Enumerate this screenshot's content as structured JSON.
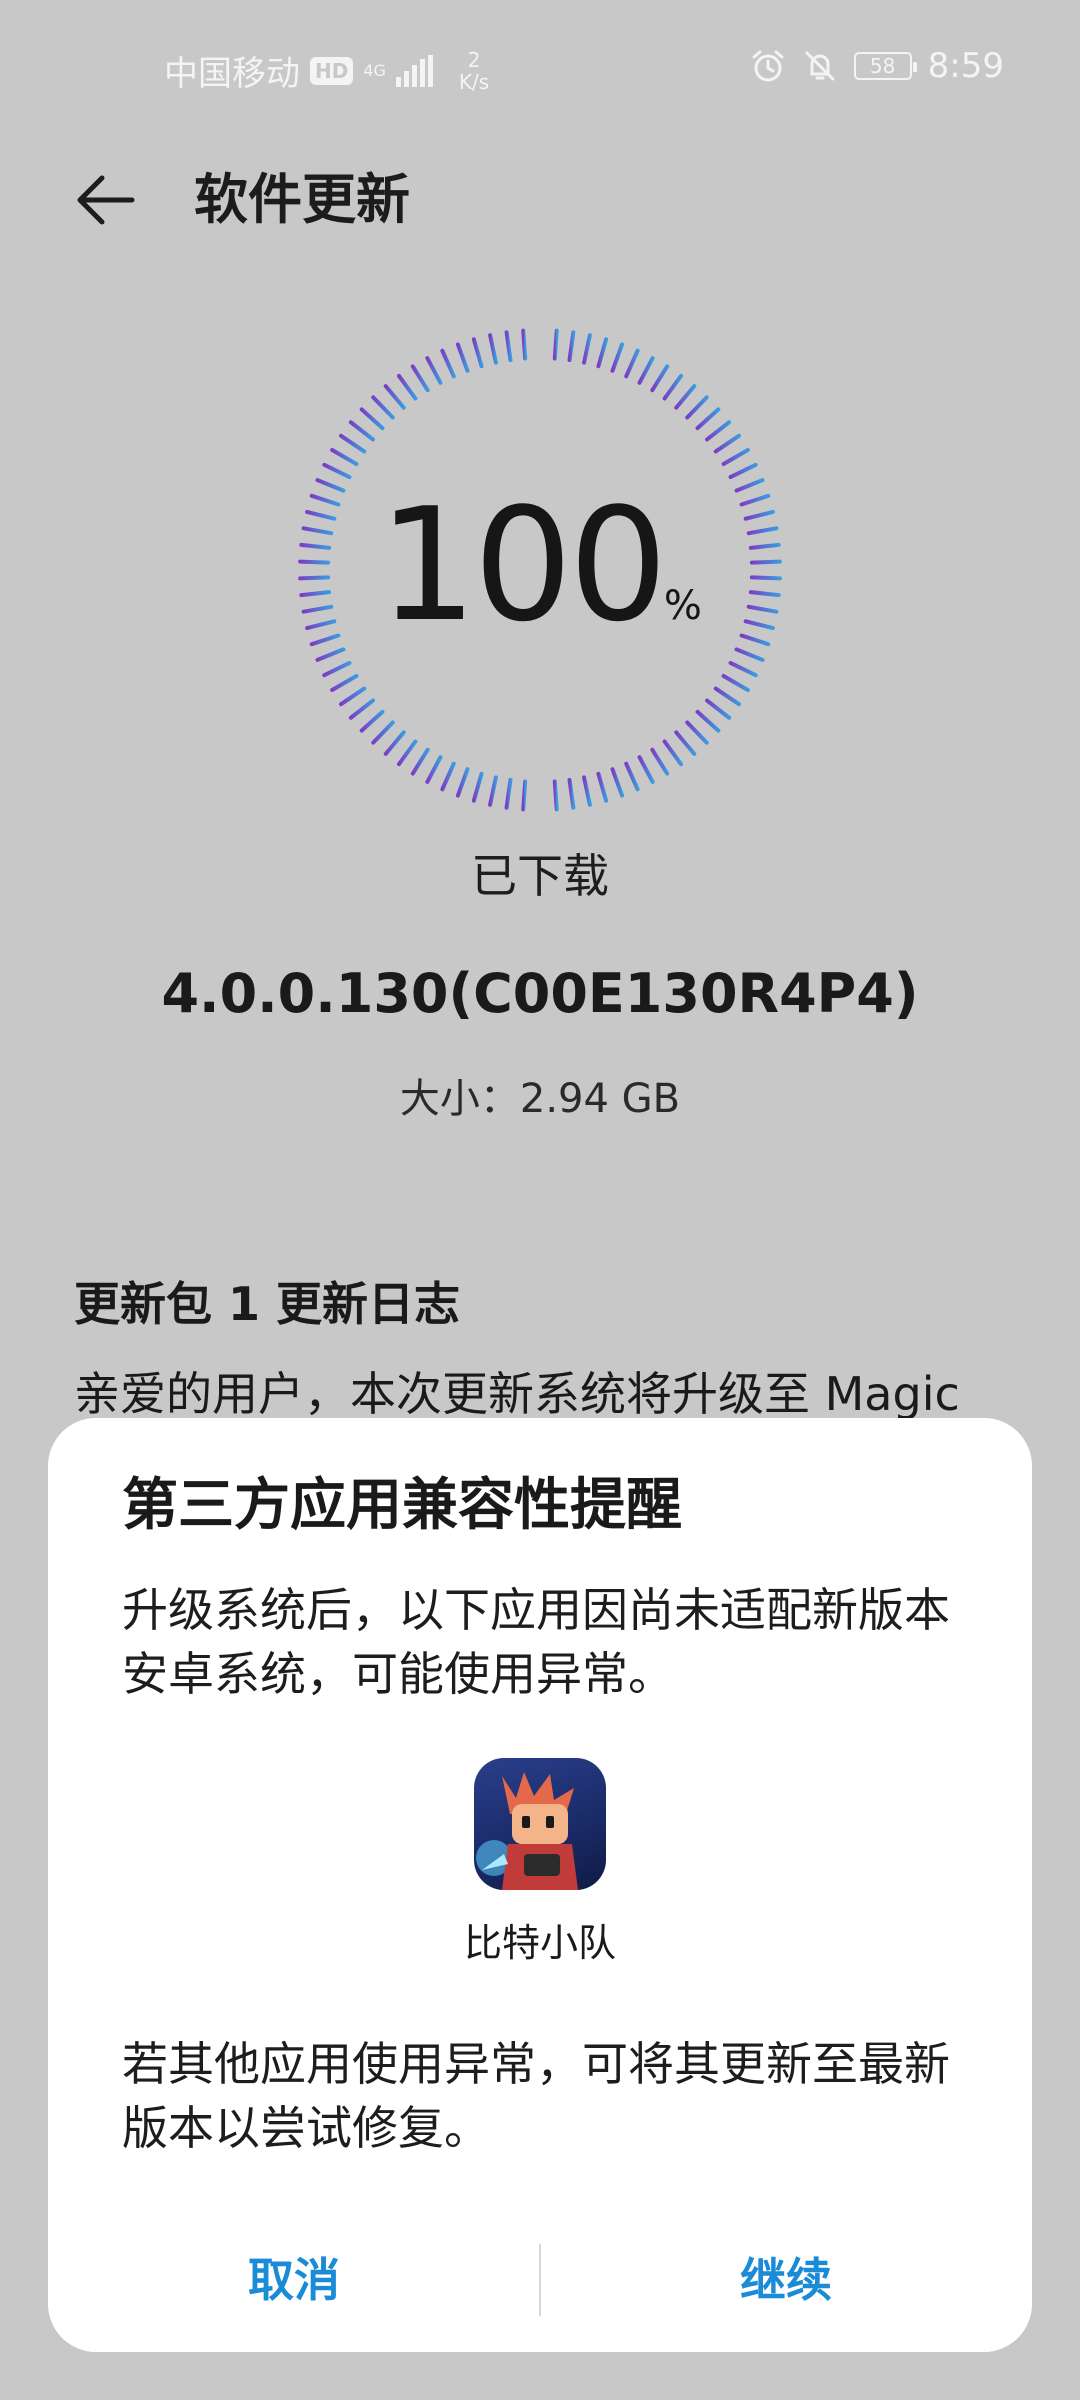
{
  "status_bar": {
    "carrier": "中国移动",
    "hd": "HD",
    "network": "4G",
    "speed_value": "2",
    "speed_unit": "K/s",
    "battery": "58",
    "time": "8:59"
  },
  "header": {
    "title": "软件更新"
  },
  "progress": {
    "value": "100",
    "unit": "%",
    "fraction": 1.0,
    "status": "已下载"
  },
  "update": {
    "version": "4.0.0.130(C00E130R4P4)",
    "size": "大小：2.94 GB"
  },
  "changelog": {
    "title": "更新包 1 更新日志",
    "text": "亲爱的用户，本次更新系统将升级至 Magic"
  },
  "dialog": {
    "title": "第三方应用兼容性提醒",
    "body": "升级系统后，以下应用因尚未适配新版本安卓系统，可能使用异常。",
    "app_name": "比特小队",
    "note": "若其他应用使用异常，可将其更新至最新版本以尝试修复。",
    "cancel_label": "取消",
    "continue_label": "继续"
  },
  "colors": {
    "accent": "#1a8bd6",
    "ring_start": "#7a3fc4",
    "ring_end": "#3b9be0",
    "scrim": "#c8c8c8"
  }
}
